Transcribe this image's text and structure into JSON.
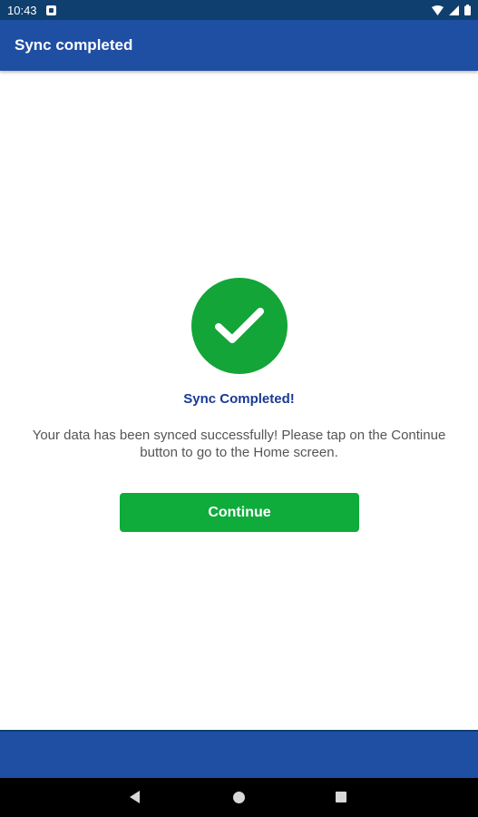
{
  "status_bar": {
    "time": "10:43",
    "icons": [
      "notification-icon",
      "wifi-icon",
      "signal-icon",
      "battery-icon"
    ]
  },
  "app_bar": {
    "title": "Sync completed"
  },
  "success": {
    "icon": "checkmark-icon",
    "headline": "Sync Completed!",
    "message": "Your data has been synced successfully! Please tap on the Continue button to go to the Home screen."
  },
  "actions": {
    "continue_label": "Continue"
  },
  "nav_bar": {
    "icons": [
      "back-icon",
      "home-icon",
      "recents-icon"
    ]
  },
  "colors": {
    "status_bar": "#0f3f6f",
    "app_bar": "#1f4fa3",
    "success_green": "#13a538",
    "button_green": "#0fac3b",
    "headline_blue": "#1a3a94",
    "body_text": "#555555"
  }
}
